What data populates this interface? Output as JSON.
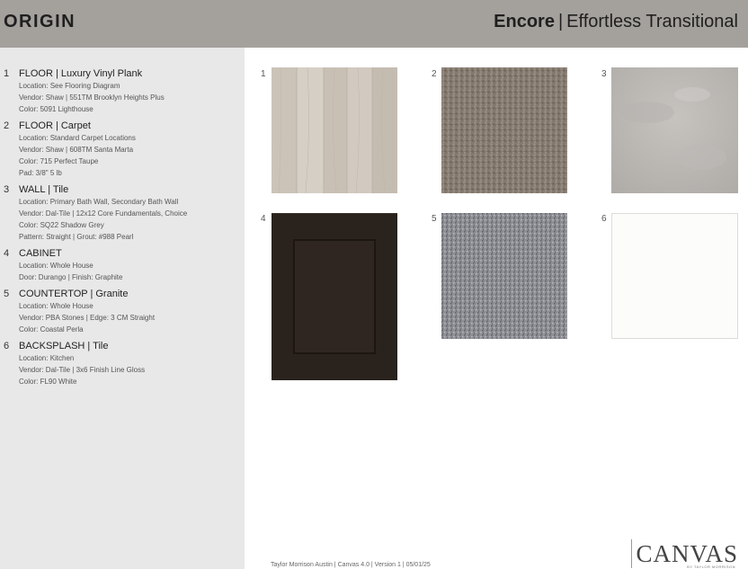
{
  "header": {
    "brand": "ORIGIN",
    "collection_bold": "Encore",
    "separator": "|",
    "collection_name": "Effortless Transitional"
  },
  "items": [
    {
      "number": "1",
      "title": "FLOOR | Luxury Vinyl Plank",
      "lines": [
        "Location: See Flooring Diagram",
        "Vendor: Shaw | 551TM Brooklyn Heights Plus",
        "Color: 5091 Lighthouse"
      ]
    },
    {
      "number": "2",
      "title": "FLOOR | Carpet",
      "lines": [
        "Location: Standard Carpet Locations",
        "Vendor: Shaw | 608TM Santa Marta",
        "Color: 715 Perfect Taupe",
        "Pad: 3/8\" 5 lb"
      ]
    },
    {
      "number": "3",
      "title": "WALL | Tile",
      "lines": [
        "Location: Primary Bath Wall, Secondary Bath Wall",
        "Vendor: Dal-Tile | 12x12 Core Fundamentals, Choice",
        "Color: SQ22 Shadow Grey",
        "Pattern: Straight | Grout: #988 Pearl"
      ]
    },
    {
      "number": "4",
      "title": "CABINET",
      "lines": [
        "Location: Whole House",
        "Door: Durango | Finish: Graphite"
      ]
    },
    {
      "number": "5",
      "title": "COUNTERTOP | Granite",
      "lines": [
        "Location: Whole House",
        "Vendor: PBA Stones | Edge: 3 CM Straight",
        "Color: Coastal Perla"
      ]
    },
    {
      "number": "6",
      "title": "BACKSPLASH | Tile",
      "lines": [
        "Location: Kitchen",
        "Vendor: Dal-Tile | 3x6 Finish Line Gloss",
        "Color: FL90 White"
      ]
    }
  ],
  "swatches": [
    {
      "number": "1",
      "icon": "wood-plank-swatch"
    },
    {
      "number": "2",
      "icon": "carpet-swatch"
    },
    {
      "number": "3",
      "icon": "stone-tile-swatch"
    },
    {
      "number": "4",
      "icon": "cabinet-door-swatch"
    },
    {
      "number": "5",
      "icon": "granite-swatch"
    },
    {
      "number": "6",
      "icon": "white-tile-swatch"
    }
  ],
  "footer": "Taylor Morrison Austin | Canvas 4.0 | Version 1 | 05/01/25",
  "logo": {
    "text": "CANVAS",
    "subtext": "BY TAYLOR MORRISON"
  }
}
